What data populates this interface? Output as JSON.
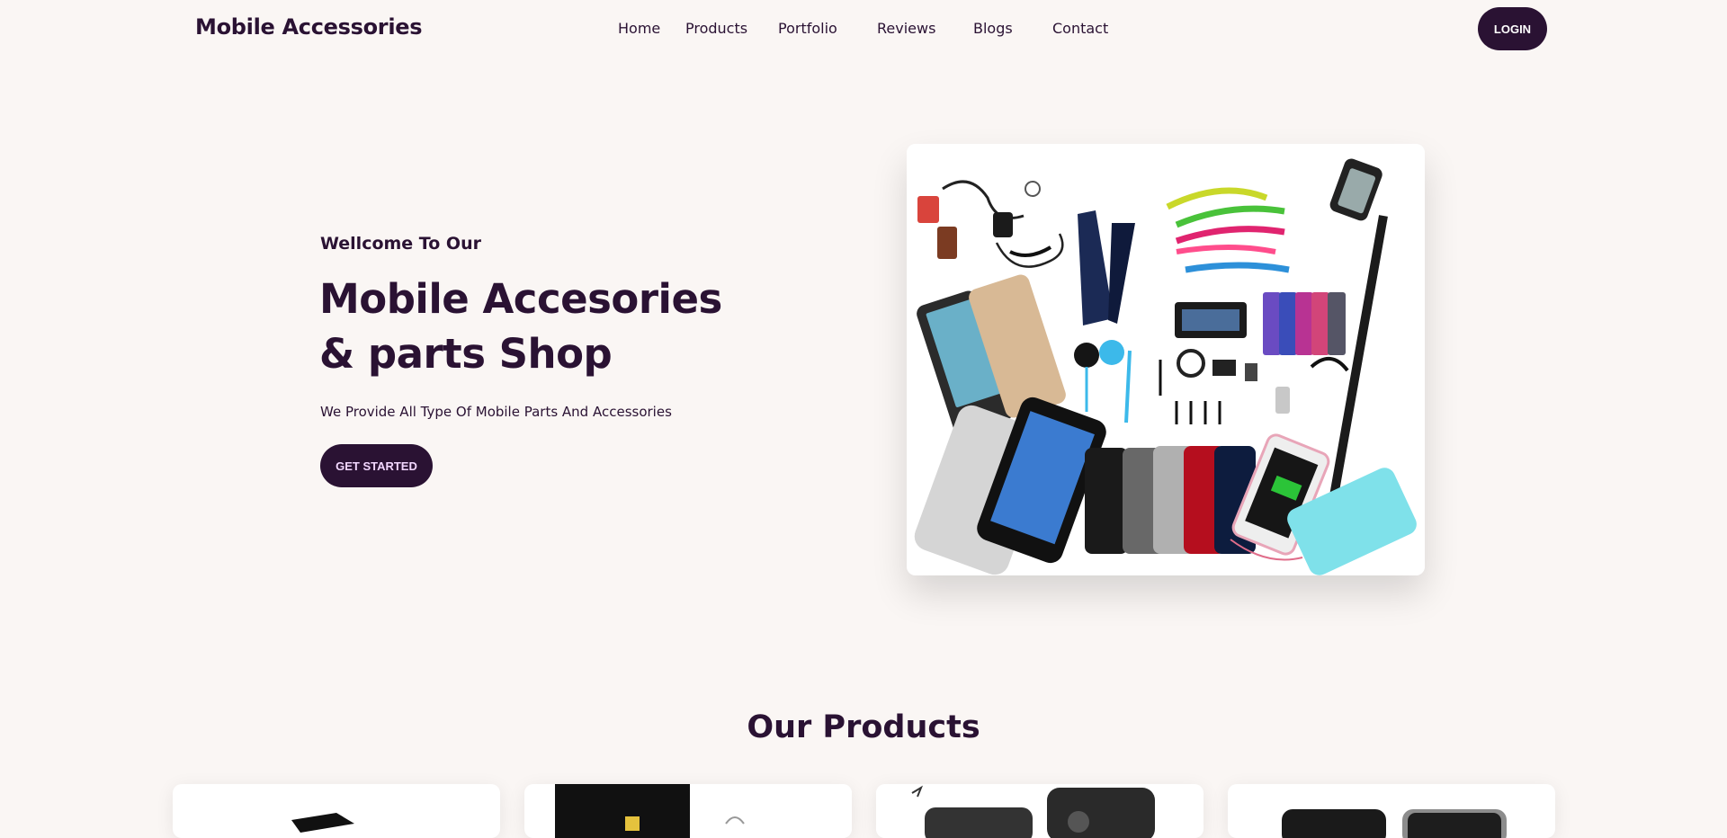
{
  "brand": "Mobile Accessories",
  "nav": {
    "links": [
      "Home",
      "Products",
      "Portfolio",
      "Reviews",
      "Blogs",
      "Contact"
    ],
    "login": "LOGIN"
  },
  "hero": {
    "subtitle": "Wellcome To Our",
    "title": "Mobile Accesories & parts Shop",
    "description": "We Provide All Type Of Mobile Parts And Accessories",
    "cta": "GET STARTED"
  },
  "products": {
    "title": "Our Products"
  },
  "colors": {
    "background": "#faf6f4",
    "primary": "#2a1233",
    "button_text": "#f2d7ff"
  }
}
